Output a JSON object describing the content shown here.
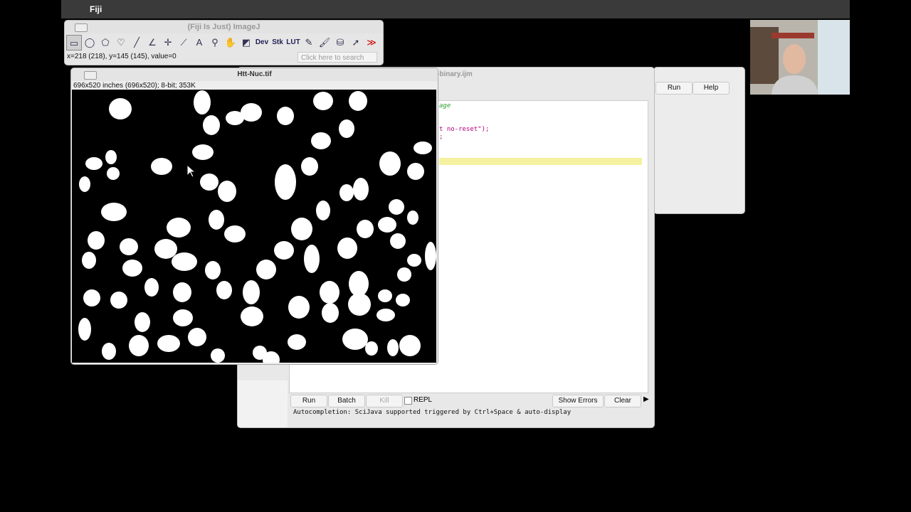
{
  "menubar": {
    "app_name": "Fiji",
    "apple_icon": "apple-icon"
  },
  "imagej": {
    "title": "(Fiji Is Just) ImageJ",
    "tools": [
      "rectangle-tool-icon",
      "oval-tool-icon",
      "polygon-tool-icon",
      "freehand-tool-icon",
      "line-tool-icon",
      "angle-tool-icon",
      "point-tool-icon",
      "wand-tool-icon",
      "text-tool-icon",
      "magnifier-tool-icon",
      "hand-tool-icon",
      "color-picker-icon"
    ],
    "dev_label": "Dev",
    "stk_label": "Stk",
    "lut_label": "LUT",
    "status": "x=218 (218), y=145 (145), value=0",
    "search_placeholder": "Click here to search"
  },
  "image_window": {
    "title": "Htt-Nuc.tif",
    "info": "696x520 inches (696x520); 8-bit; 353K"
  },
  "script_editor": {
    "title_fragment": "-binary.ijm",
    "code_lines": [
      "age",
      "t no-reset\");",
      ";"
    ],
    "run_button": "Run",
    "batch_button": "Batch",
    "kill_button": "Kill",
    "repl_label": "REPL",
    "show_errors_button": "Show Errors",
    "clear_button": "Clear",
    "autocompletion": "Autocompletion: SciJava supported triggered by Ctrl+Space & auto-display"
  },
  "background_window": {
    "run_button": "Run",
    "help_button": "Help"
  },
  "colors": {
    "code_green": "#2a9d2a",
    "code_purple": "#b3007a",
    "highlight": "#f4f1a0"
  }
}
